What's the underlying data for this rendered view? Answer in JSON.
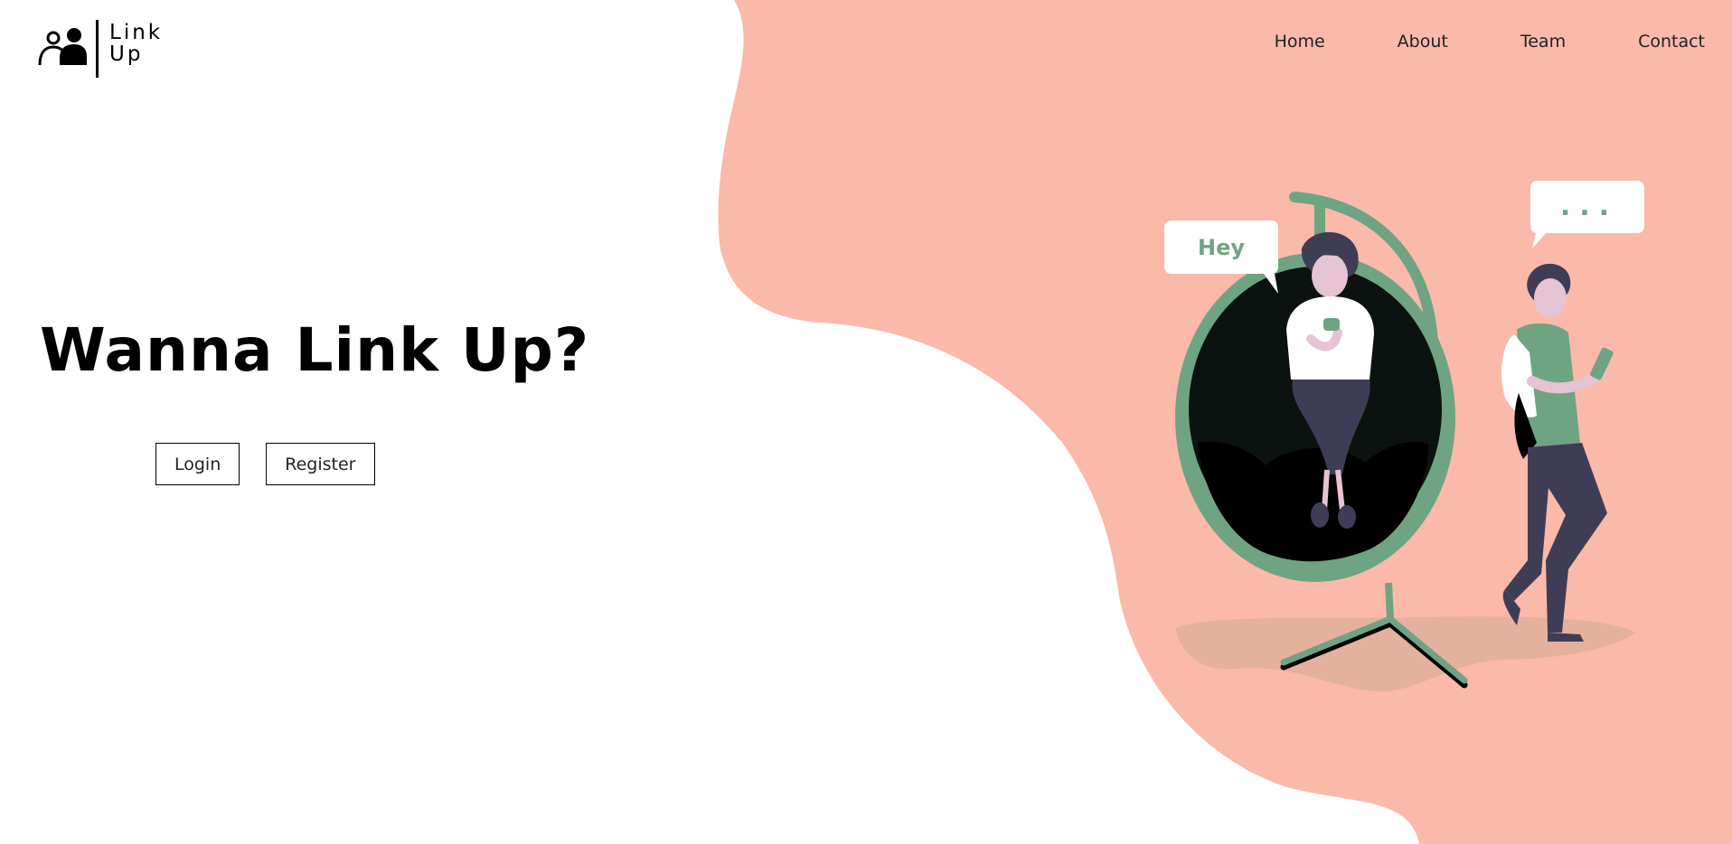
{
  "brand": {
    "logo_line1": "Link",
    "logo_line2": "Up"
  },
  "nav": {
    "items": [
      {
        "label": "Home"
      },
      {
        "label": "About"
      },
      {
        "label": "Team"
      },
      {
        "label": "Contact"
      }
    ]
  },
  "hero": {
    "title": "Wanna Link Up?",
    "login_label": "Login",
    "register_label": "Register"
  },
  "illustration": {
    "bubble_left": "Hey",
    "bubble_right": "..."
  },
  "colors": {
    "blob": "#fbb9a9",
    "accent_green": "#6fa482",
    "dark_navy": "#3f3d56",
    "skin": "#e5c3d2"
  }
}
